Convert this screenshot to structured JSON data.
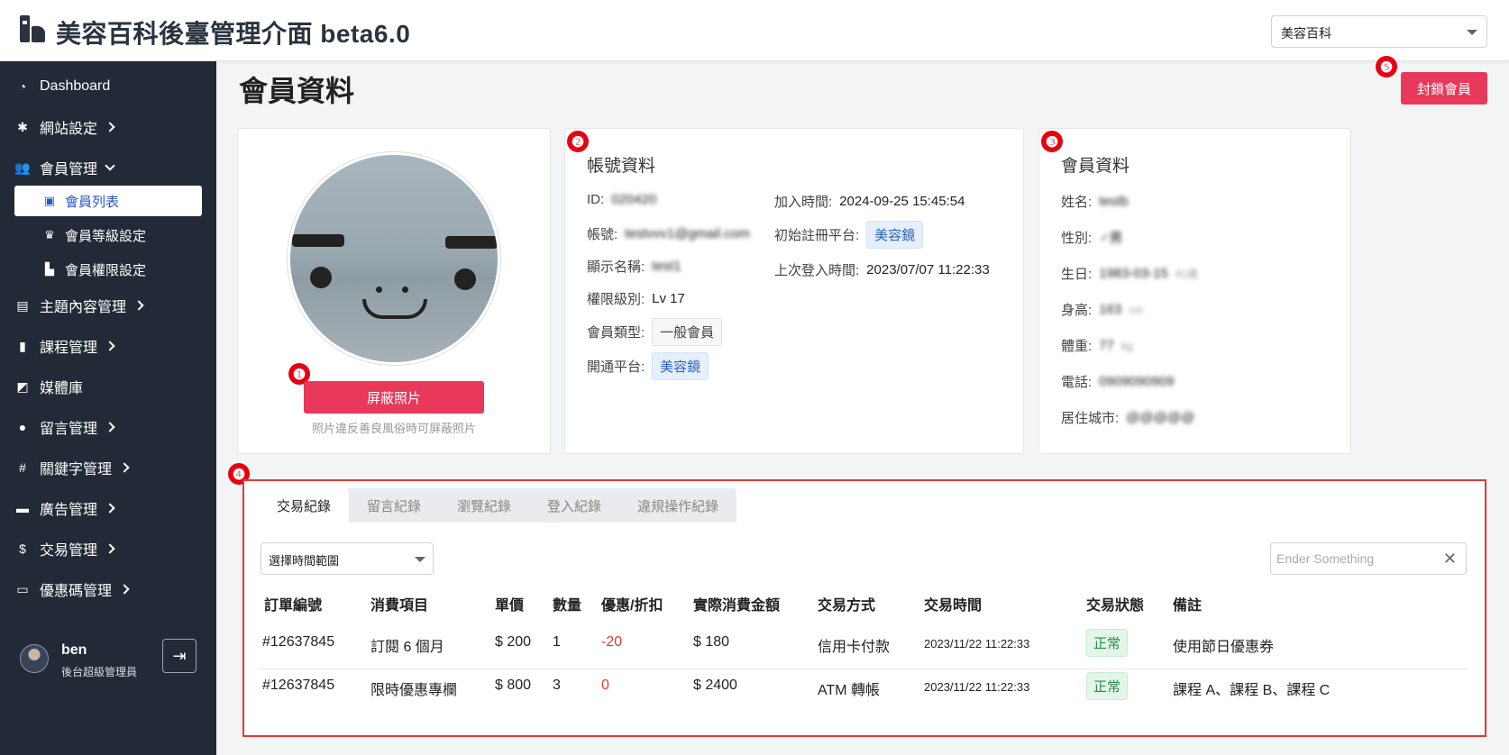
{
  "app": {
    "title": "美容百科後臺管理介面 beta6.0"
  },
  "site_select": {
    "value": "美容百科"
  },
  "sidebar": {
    "items": [
      {
        "label": "Dashboard",
        "icon": "dashboard-icon"
      },
      {
        "label": "網站設定",
        "icon": "gear-icon"
      },
      {
        "label": "會員管理",
        "icon": "users-icon"
      },
      {
        "label": "主題內容管理",
        "icon": "book-icon"
      },
      {
        "label": "課程管理",
        "icon": "course-icon"
      },
      {
        "label": "媒體庫",
        "icon": "images-icon"
      },
      {
        "label": "留言管理",
        "icon": "comment-icon"
      },
      {
        "label": "關鍵字管理",
        "icon": "hashtag-icon"
      },
      {
        "label": "廣告管理",
        "icon": "ad-icon"
      },
      {
        "label": "交易管理",
        "icon": "money-bag-icon"
      },
      {
        "label": "優惠碼管理",
        "icon": "ticket-icon"
      }
    ],
    "member_sub": [
      {
        "label": "會員列表"
      },
      {
        "label": "會員等級設定"
      },
      {
        "label": "會員權限設定"
      }
    ],
    "user": {
      "name": "ben",
      "role": "後台超級管理員"
    }
  },
  "page": {
    "title": "會員資料",
    "ban_label": "封鎖會員",
    "markers": [
      "❶",
      "❷",
      "❸",
      "❹",
      "❺"
    ]
  },
  "photo_card": {
    "block_label": "屏蔽照片",
    "hint": "照片違反善良風俗時可屏蔽照片"
  },
  "account": {
    "title": "帳號資料",
    "id_label": "ID:",
    "id": "020420",
    "account_label": "帳號:",
    "account": "testvvv1@gmail.com",
    "display_label": "顯示名稱:",
    "display": "test1",
    "level_label": "權限級別:",
    "level": "Lv 17",
    "type_label": "會員類型:",
    "type": "一般會員",
    "platform_label": "開通平台:",
    "platform": "美容鏡",
    "joined_label": "加入時間:",
    "joined": "2024-09-25 15:45:54",
    "first_platform_label": "初始註冊平台:",
    "first_platform": "美容鏡",
    "last_login_label": "上次登入時間:",
    "last_login": "2023/07/07 11:22:33"
  },
  "member": {
    "title": "會員資料",
    "name_label": "姓名:",
    "name": "testb",
    "gender_label": "性別:",
    "gender": "♂男",
    "birth_label": "生日:",
    "birth": "1983-03-15",
    "age": "41歲",
    "height_label": "身高:",
    "height": "163",
    "height_unit": "cm",
    "weight_label": "體重:",
    "weight": "77",
    "weight_unit": "kg",
    "phone_label": "電話:",
    "phone": "0909090909",
    "city_label": "居住城市:",
    "city": "@@@@@"
  },
  "records": {
    "tabs": [
      "交易紀錄",
      "留言紀錄",
      "瀏覽紀錄",
      "登入紀錄",
      "違規操作紀錄"
    ],
    "range_select": "選擇時間範圍",
    "search_placeholder": "Ender Something",
    "headers": [
      "訂單編號",
      "消費項目",
      "單價",
      "數量",
      "優惠/折扣",
      "實際消費金額",
      "交易方式",
      "交易時間",
      "交易狀態",
      "備註"
    ],
    "rows": [
      [
        "#12637845",
        "訂閱 6 個月",
        "$ 200",
        "1",
        "-20",
        "$ 180",
        "信用卡付款",
        "2023/11/22 11:22:33",
        "正常",
        "使用節日優惠券"
      ],
      [
        "#12637845",
        "限時優惠專欄",
        "$ 800",
        "3",
        "0",
        "$ 2400",
        "ATM 轉帳",
        "2023/11/22 11:22:33",
        "正常",
        "課程 A、課程 B、課程 C"
      ]
    ]
  },
  "colors": {
    "accent_red": "#e8395a",
    "sidebar_bg": "#222a37",
    "link_blue": "#2a62c9",
    "highlight_border": "#e53935"
  }
}
